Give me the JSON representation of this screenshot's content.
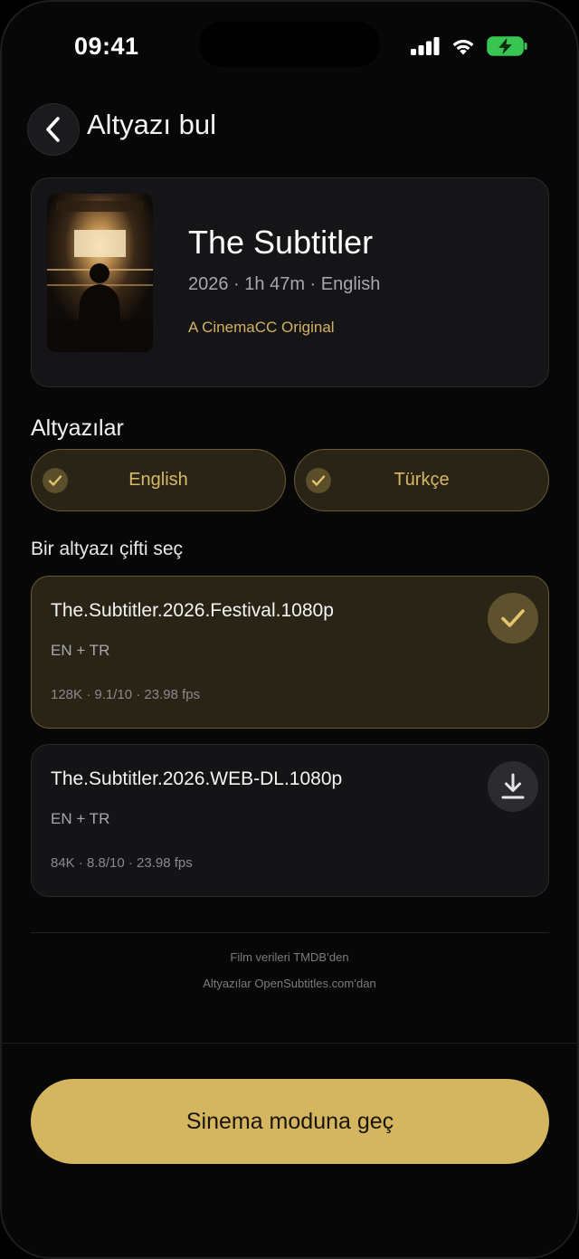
{
  "status_bar": {
    "time": "09:41"
  },
  "header": {
    "title": "Altyazı bul"
  },
  "movie": {
    "title": "The Subtitler",
    "meta": "2026 · 1h 47m · English",
    "brand": "A CinemaCC Original"
  },
  "subtitles": {
    "section_title": "Altyazılar",
    "languages": [
      {
        "label": "English",
        "selected": true
      },
      {
        "label": "Türkçe",
        "selected": true
      }
    ]
  },
  "pairs": {
    "title": "Bir altyazı çifti seç",
    "items": [
      {
        "name": "The.Subtitler.2026.Festival.1080p",
        "langs": "EN + TR",
        "stats": "128K · 9.1/10 · 23.98 fps",
        "state": "selected"
      },
      {
        "name": "The.Subtitler.2026.WEB-DL.1080p",
        "langs": "EN + TR",
        "stats": "84K · 8.8/10 · 23.98 fps",
        "state": "download"
      }
    ]
  },
  "credits": {
    "line1": "Film verileri TMDB’den",
    "line2": "Altyazılar OpenSubtitles.com’dan"
  },
  "cta": {
    "label": "Sinema moduna geç"
  },
  "colors": {
    "accent": "#d5b660",
    "selected_bg": "#2a2416",
    "card_bg": "#141416"
  },
  "icons": {
    "back": "chevron-left-icon",
    "check": "check-icon",
    "download": "download-icon",
    "signal": "cellular-signal-icon",
    "wifi": "wifi-icon",
    "battery": "battery-charging-icon"
  }
}
